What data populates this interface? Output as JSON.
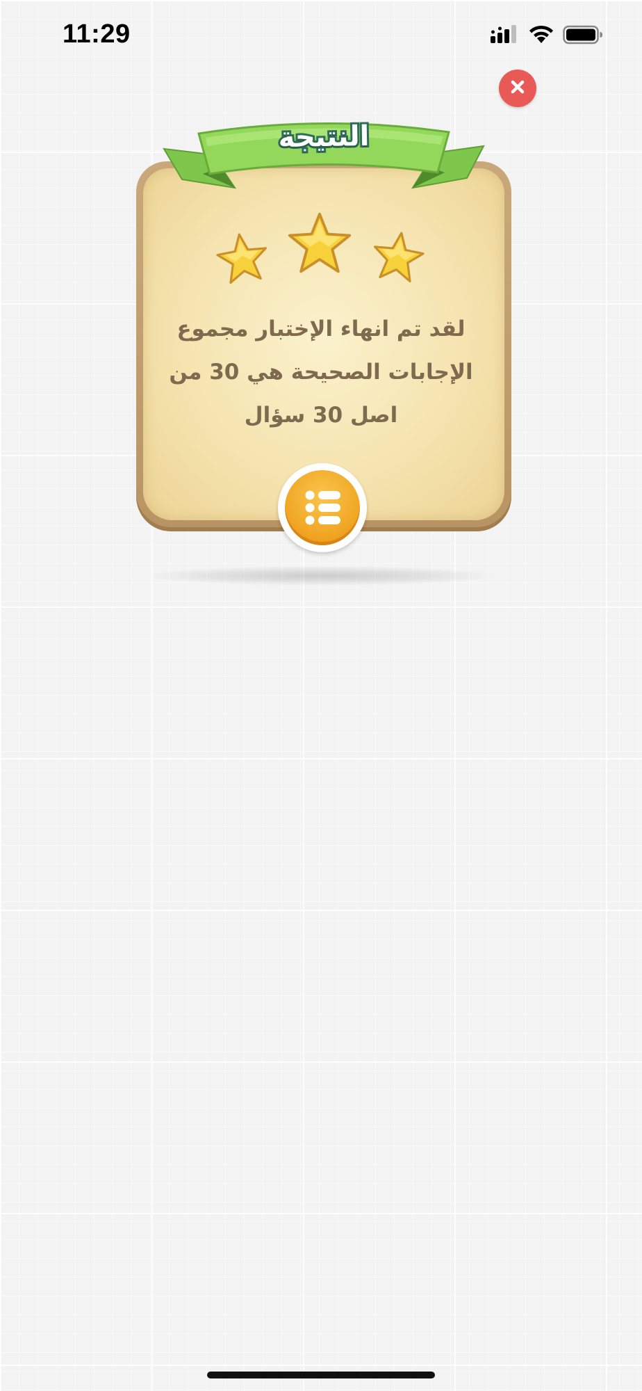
{
  "status_bar": {
    "time": "11:29",
    "icons": [
      "cellular-signal-icon",
      "wifi-icon",
      "battery-icon"
    ]
  },
  "close_button": {
    "icon": "close-icon",
    "color": "#e95a57"
  },
  "result_card": {
    "title": "النتيجة",
    "stars_earned": 3,
    "stars_total": 3,
    "message": "لقد تم انهاء الإختبار مجموع الإجابات الصحيحة هي 30 من اصل 30 سؤال",
    "review_button_icon": "list-icon"
  },
  "colors": {
    "ribbon": "#8fd45a",
    "card": "#f5e4b0",
    "star": "#f7d13a",
    "button": "#f0a21f"
  }
}
